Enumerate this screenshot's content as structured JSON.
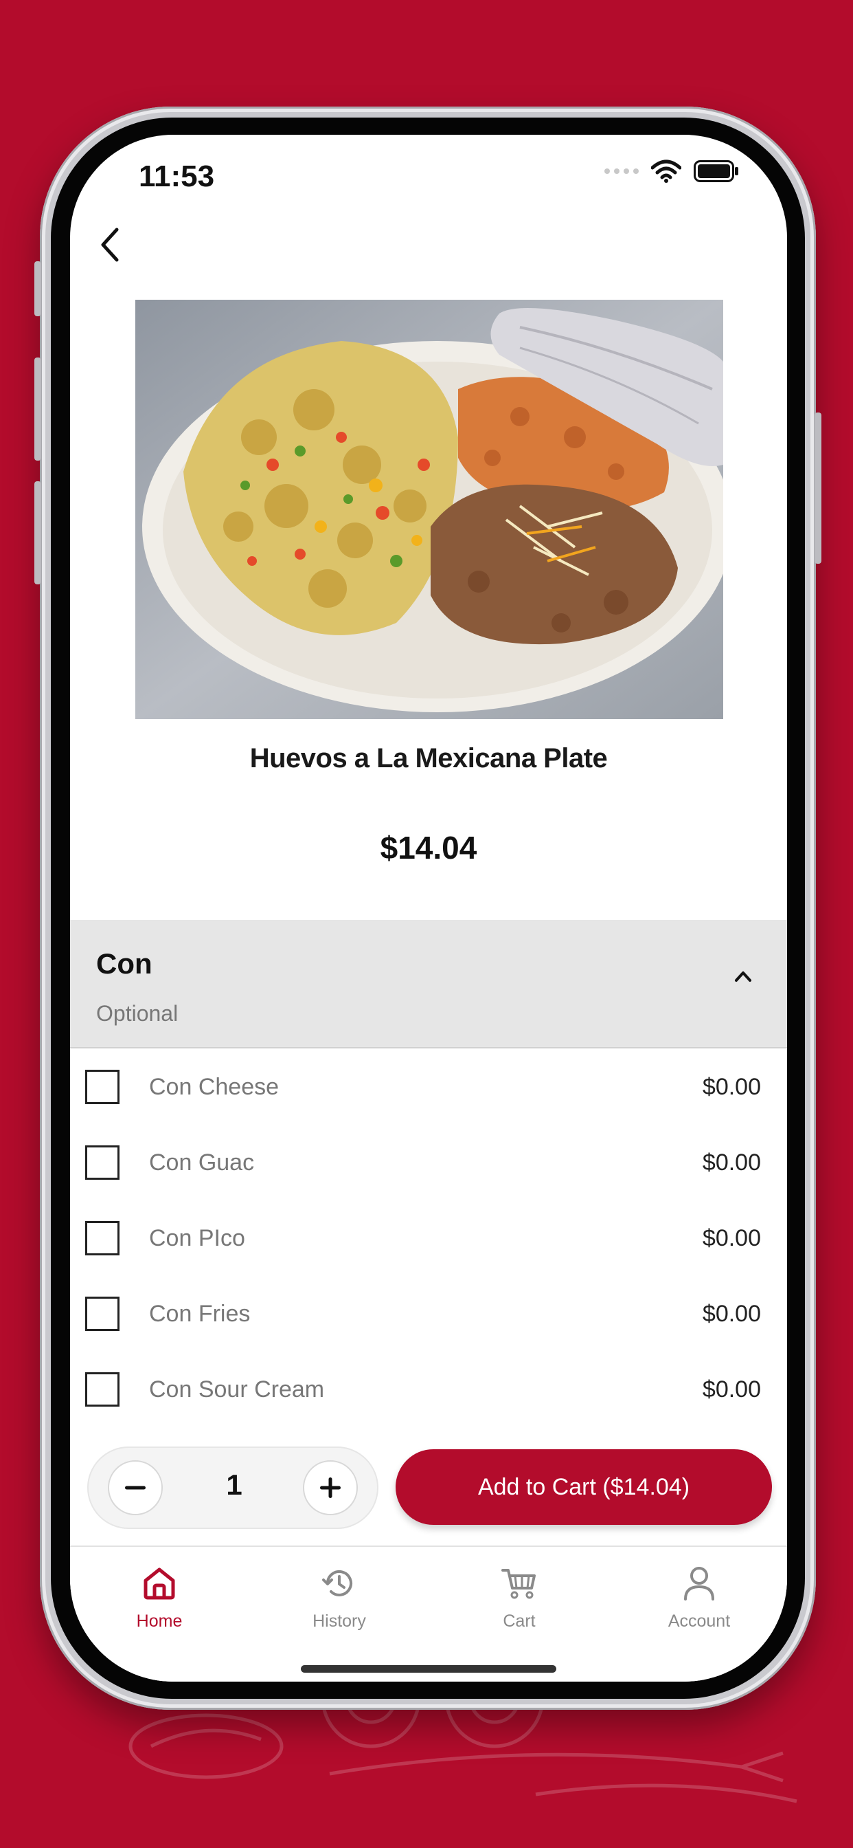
{
  "status_bar": {
    "time": "11:53"
  },
  "product": {
    "title": "Huevos a La Mexicana Plate",
    "price": "$14.04"
  },
  "section": {
    "title": "Con",
    "subtitle": "Optional",
    "options": [
      {
        "label": "Con Cheese",
        "price": "$0.00"
      },
      {
        "label": "Con Guac",
        "price": "$0.00"
      },
      {
        "label": "Con PIco",
        "price": "$0.00"
      },
      {
        "label": "Con Fries",
        "price": "$0.00"
      },
      {
        "label": "Con Sour Cream",
        "price": "$0.00"
      }
    ]
  },
  "quantity": {
    "value": "1"
  },
  "add_to_cart": {
    "label": "Add to Cart ($14.04)"
  },
  "tabs": [
    {
      "label": "Home",
      "icon": "home-icon",
      "active": true
    },
    {
      "label": "History",
      "icon": "history-icon",
      "active": false
    },
    {
      "label": "Cart",
      "icon": "cart-icon",
      "active": false
    },
    {
      "label": "Account",
      "icon": "account-icon",
      "active": false
    }
  ],
  "colors": {
    "brand": "#b30c2c",
    "background": "#b30c2c",
    "section_header": "#e6e6e6"
  }
}
